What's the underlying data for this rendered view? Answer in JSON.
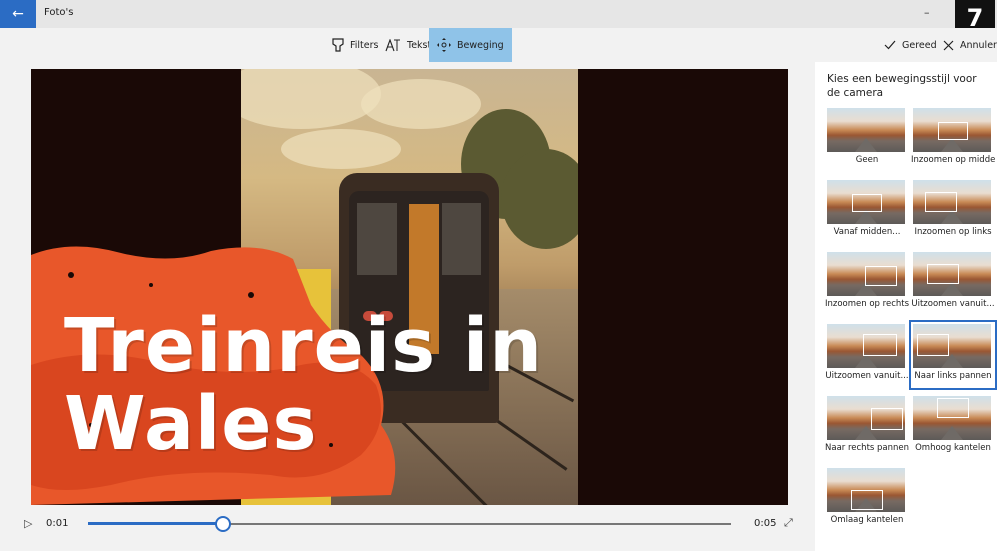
{
  "window": {
    "title": "Foto's",
    "minimize_glyph": "–"
  },
  "step_badge": "7",
  "toolbar": {
    "filters_label": "Filters",
    "text_label": "Tekst",
    "motion_label": "Beweging",
    "done_label": "Gereed",
    "cancel_label": "Annuleren"
  },
  "video": {
    "title_line1": "Treinreis in",
    "title_line2": "Wales"
  },
  "timeline": {
    "current_time": "0:01",
    "duration": "0:05",
    "progress_fraction": 0.21
  },
  "motion_panel": {
    "heading": "Kies een bewegingsstijl voor de camera",
    "styles": [
      {
        "label": "Geen"
      },
      {
        "label": "Inzoomen op midden"
      },
      {
        "label": "Vanaf midden..."
      },
      {
        "label": "Inzoomen op links"
      },
      {
        "label": "Inzoomen op rechts"
      },
      {
        "label": "Uitzoomen vanuit..."
      },
      {
        "label": "Uitzoomen vanuit..."
      },
      {
        "label": "Naar links pannen",
        "selected": true
      },
      {
        "label": "Naar rechts pannen"
      },
      {
        "label": "Omhoog kantelen"
      },
      {
        "label": "Omlaag kantelen"
      }
    ]
  },
  "colors": {
    "accent": "#2b6cc4",
    "active_tool": "#8fc3e8",
    "splash": "#e8572a"
  }
}
